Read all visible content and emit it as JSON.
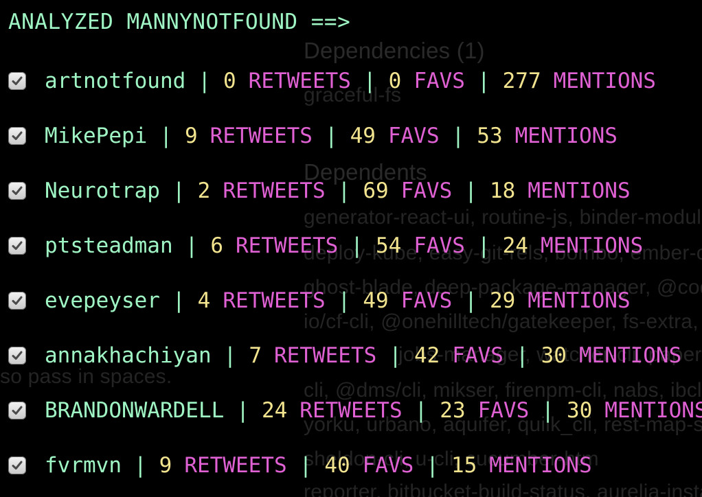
{
  "header": "ANALYZED MANNYNOTFOUND ==>",
  "labels": {
    "retweets": "RETWEETS",
    "favs": "FAVS",
    "mentions": "MENTIONS",
    "separator": "|"
  },
  "rows": [
    {
      "user": "artnotfound",
      "retweets": "0",
      "favs": "0",
      "mentions": "277"
    },
    {
      "user": "MikePepi",
      "retweets": "9",
      "favs": "49",
      "mentions": "53"
    },
    {
      "user": "Neurotrap",
      "retweets": "2",
      "favs": "69",
      "mentions": "18"
    },
    {
      "user": "ptsteadman",
      "retweets": "6",
      "favs": "54",
      "mentions": "24"
    },
    {
      "user": "evepeyser",
      "retweets": "4",
      "favs": "49",
      "mentions": "29"
    },
    {
      "user": "annakhachiyan",
      "retweets": "7",
      "favs": "42",
      "mentions": "30"
    },
    {
      "user": "BRANDONWARDELL",
      "retweets": "24",
      "favs": "23",
      "mentions": "30"
    },
    {
      "user": "fvrmvn",
      "retweets": "9",
      "favs": "40",
      "mentions": "15"
    }
  ],
  "background_text": {
    "dependencies_heading": "Dependencies (1)",
    "dependency_1": "graceful-fs",
    "dependents_heading": "Dependents",
    "line_1": "generator-react-ui, routine-js, binder-module, b",
    "line_2": "deploy-kube, easy-git-rels, bombo, ember-clien",
    "line_3": "ghost-blade, deep-package-manager, @codefr",
    "line_4": "io/cf-cli, @onehilltech/gatekeeper, fs-extra, @d",
    "line_5": "jobs-manager, watcher-cli, paper",
    "line_6": "so pass in spaces.",
    "line_7": "cli, @dms/cli, mikser, firenpm-cli, nabs, ibcli, ee",
    "line_8": "yorku, urbano, aquifer, quilk_cli, rest-map-serve",
    "line_9": "sheldon-cli, u-cli, cucumber-htm",
    "line_10": "reporter, bitbucket-build-status, aurelia-install"
  },
  "colors": {
    "background": "#000000",
    "user": "#9ff5c3",
    "number": "#f2e38f",
    "label": "#e061d3",
    "ghost_text": "#242424"
  }
}
